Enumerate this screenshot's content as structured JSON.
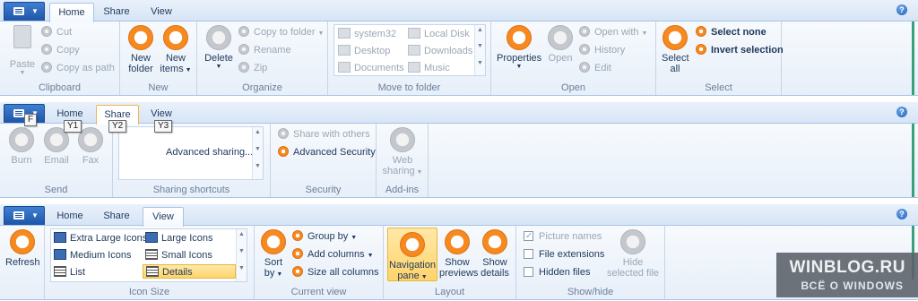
{
  "tabs_bar": {
    "home": "Home",
    "share": "Share",
    "view": "View",
    "help_icon": "?"
  },
  "home": {
    "clipboard": {
      "paste": "Paste",
      "cut": "Cut",
      "copy": "Copy",
      "copy_as_path": "Copy as path",
      "label": "Clipboard"
    },
    "new": {
      "new_folder_l1": "New",
      "new_folder_l2": "folder",
      "new_items_l1": "New",
      "new_items_l2": "items",
      "label": "New"
    },
    "organize": {
      "delete": "Delete",
      "copy_to_folder": "Copy to folder",
      "rename": "Rename",
      "zip": "Zip",
      "label": "Organize"
    },
    "move_to_folder": {
      "items": [
        "system32",
        "Local Disk",
        "Desktop",
        "Downloads",
        "Documents",
        "Music"
      ],
      "label": "Move to folder"
    },
    "open": {
      "properties": "Properties",
      "open": "Open",
      "open_with": "Open with",
      "history": "History",
      "edit": "Edit",
      "label": "Open"
    },
    "select": {
      "select_all_l1": "Select",
      "select_all_l2": "all",
      "select_none": "Select none",
      "invert_selection": "Invert selection",
      "label": "Select"
    }
  },
  "share": {
    "keytips": {
      "file": "F",
      "home": "Y1",
      "share": "Y2",
      "view": "Y3"
    },
    "send": {
      "burn": "Burn",
      "email": "Email",
      "fax": "Fax",
      "label": "Send"
    },
    "sharing_shortcuts": {
      "advanced_sharing": "Advanced sharing...",
      "label": "Sharing shortcuts"
    },
    "security": {
      "share_with_others": "Share with others",
      "advanced_security": "Advanced Security",
      "label": "Security"
    },
    "addins": {
      "web_sharing_l1": "Web",
      "web_sharing_l2": "sharing",
      "label": "Add-ins"
    }
  },
  "view": {
    "refresh": "Refresh",
    "icon_size": {
      "extra_large": "Extra Large Icons",
      "large": "Large Icons",
      "medium": "Medium Icons",
      "small": "Small Icons",
      "list": "List",
      "details": "Details",
      "label": "Icon Size"
    },
    "current_view": {
      "sort_by_l1": "Sort",
      "sort_by_l2": "by",
      "group_by": "Group by",
      "add_columns": "Add columns",
      "size_all_columns": "Size all columns",
      "label": "Current view"
    },
    "layout": {
      "navigation_pane_l1": "Navigation",
      "navigation_pane_l2": "pane",
      "show_previews_l1": "Show",
      "show_previews_l2": "previews",
      "show_details_l1": "Show",
      "show_details_l2": "details",
      "label": "Layout"
    },
    "show_hide": {
      "picture_names": "Picture names",
      "file_extensions": "File extensions",
      "hidden_files": "Hidden files",
      "hide_selected_l1": "Hide",
      "hide_selected_l2": "selected file",
      "label": "Show/hide"
    }
  },
  "watermark": {
    "line1": "WINBLOG.RU",
    "line2": "ВСЁ О WINDOWS"
  }
}
